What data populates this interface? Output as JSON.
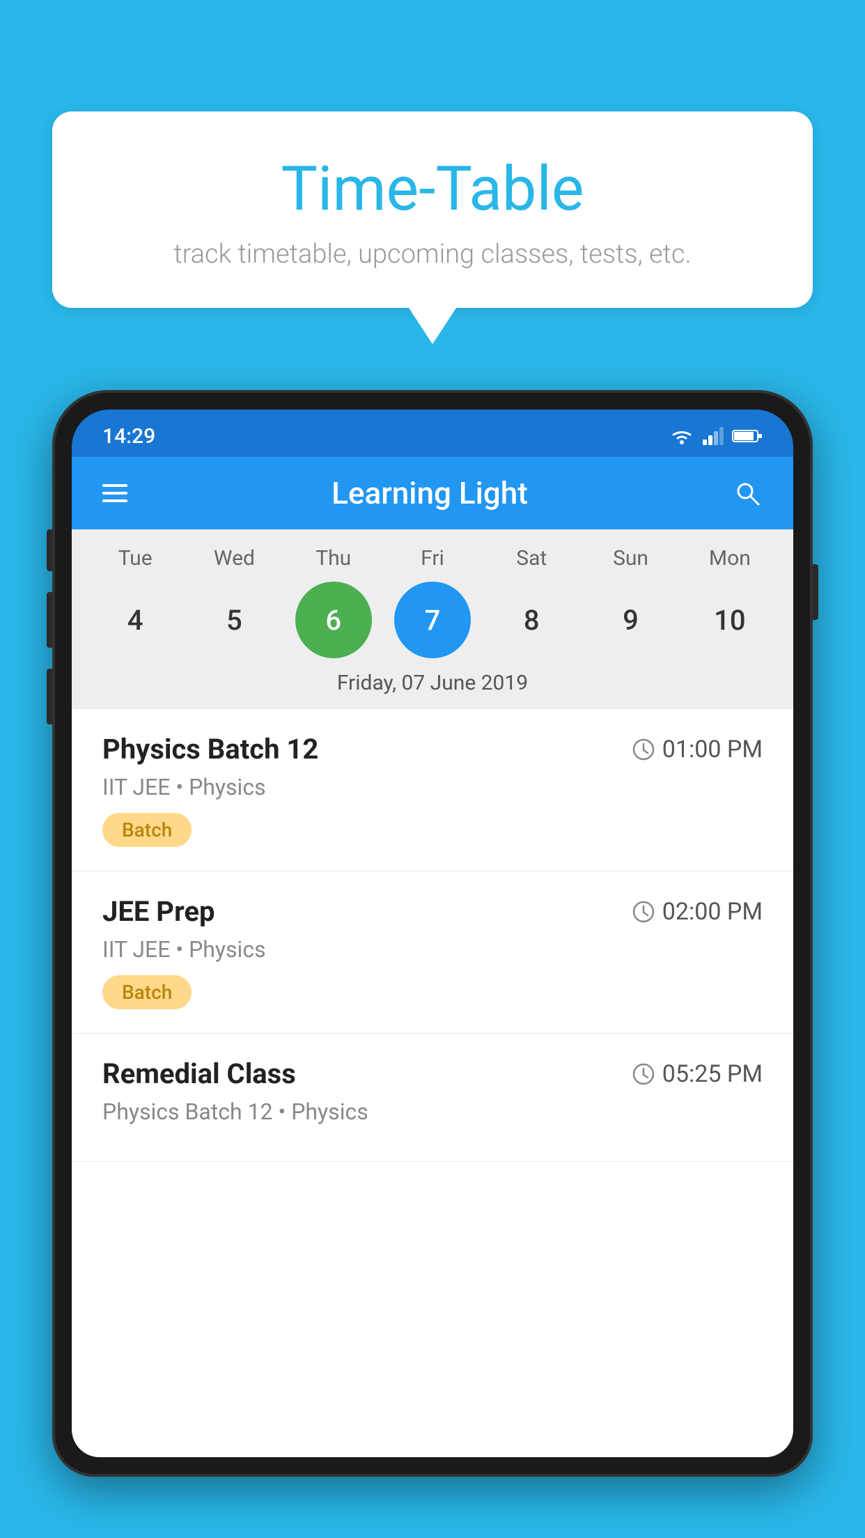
{
  "background": {
    "color": "#29b6e8"
  },
  "speech_bubble": {
    "title": "Time-Table",
    "subtitle": "track timetable, upcoming classes, tests, etc."
  },
  "phone": {
    "status_bar": {
      "time": "14:29"
    },
    "app_bar": {
      "title": "Learning Light"
    },
    "calendar": {
      "days": [
        "Tue",
        "Wed",
        "Thu",
        "Fri",
        "Sat",
        "Sun",
        "Mon"
      ],
      "dates": [
        "4",
        "5",
        "6",
        "7",
        "8",
        "9",
        "10"
      ],
      "today_index": 2,
      "selected_index": 3,
      "selected_label": "Friday, 07 June 2019"
    },
    "schedule": [
      {
        "title": "Physics Batch 12",
        "time": "01:00 PM",
        "subtitle": "IIT JEE • Physics",
        "badge": "Batch"
      },
      {
        "title": "JEE Prep",
        "time": "02:00 PM",
        "subtitle": "IIT JEE • Physics",
        "badge": "Batch"
      },
      {
        "title": "Remedial Class",
        "time": "05:25 PM",
        "subtitle": "Physics Batch 12 • Physics",
        "badge": null
      }
    ]
  }
}
